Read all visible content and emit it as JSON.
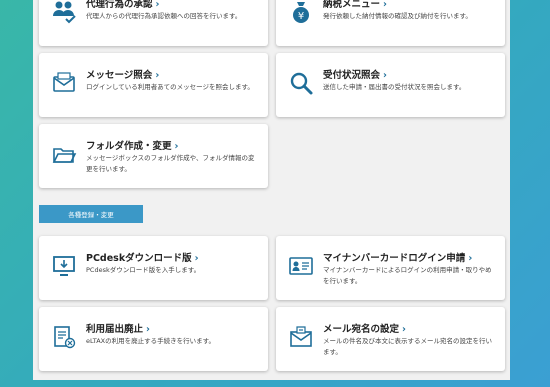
{
  "section": {
    "label": "各種登録・変更"
  },
  "cards": [
    {
      "title": "代理行為の承認",
      "desc": "代理人からの代理行為承認依頼への回答を行います。",
      "icon": "people-check-icon"
    },
    {
      "title": "納税メニュー",
      "desc": "発行依頼した納付情報の確認及び納付を行います。",
      "icon": "money-bag-icon"
    },
    {
      "title": "メッセージ照会",
      "desc": "ログインしている利用者あてのメッセージを照会します。",
      "icon": "envelope-icon"
    },
    {
      "title": "受付状況照会",
      "desc": "送信した申請・届出書の受付状況を照会します。",
      "icon": "magnifier-icon"
    },
    {
      "title": "フォルダ作成・変更",
      "desc": "メッセージボックスのフォルダ作成や、フォルダ情報の変更を行います。",
      "icon": "folder-icon"
    },
    {
      "title": "PCdeskダウンロード版",
      "desc": "PCdeskダウンロード版を入手します。",
      "icon": "monitor-download-icon"
    },
    {
      "title": "マイナンバーカードログイン申請",
      "desc": "マイナンバーカードによるログインの利用申請・取りやめを行います。",
      "icon": "id-card-icon"
    },
    {
      "title": "利用届出廃止",
      "desc": "eLTAXの利用を廃止する手続きを行います。",
      "icon": "document-cancel-icon"
    },
    {
      "title": "メール宛名の設定",
      "desc": "メールの件名及び本文に表示するメール宛名の設定を行います。",
      "icon": "mail-settings-icon"
    }
  ],
  "colors": {
    "accent": "#1f6e99",
    "section_bg": "#3b98c7"
  }
}
